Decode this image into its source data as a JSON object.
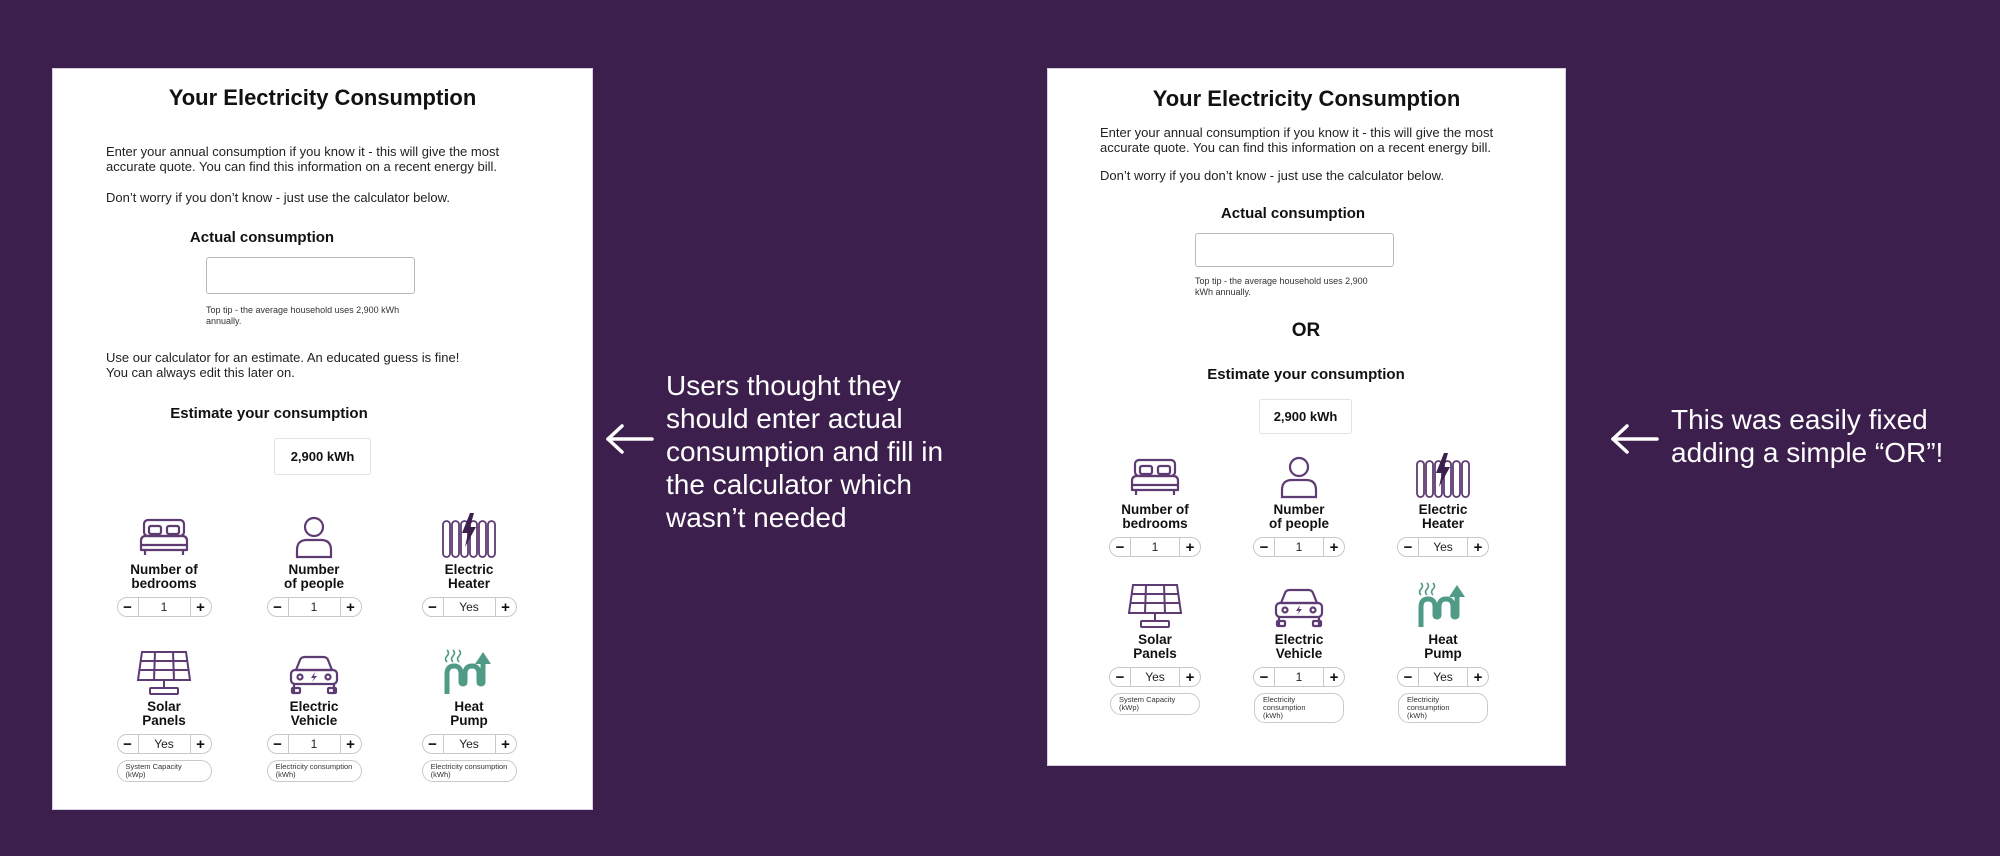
{
  "panels": {
    "left": {
      "title": "Your Electricity Consumption",
      "intro_1": "Enter your annual consumption if you know it - this will give the most accurate quote. You can find this information on a recent energy bill.",
      "intro_2": "Don’t worry if you don’t know - just use the calculator below.",
      "actual_label": "Actual consumption",
      "actual_value": "",
      "tip": "Top tip - the average household uses 2,900 kWh annually.",
      "calc_intro": "Use our calculator for an estimate. An educated guess is fine!\nYou can always edit this later on.",
      "estimate_label": "Estimate your consumption",
      "estimate_value": "2,900 kWh",
      "items": [
        {
          "label": "Number of\nbedrooms",
          "value": "1",
          "icon": "bed-icon"
        },
        {
          "label": "Number\nof people",
          "value": "1",
          "icon": "person-icon"
        },
        {
          "label": "Electric\nHeater",
          "value": "Yes",
          "icon": "electric-heater-icon"
        },
        {
          "label": "Solar\nPanels",
          "value": "Yes",
          "icon": "solar-panel-icon",
          "pill": "System Capacity (kWp)"
        },
        {
          "label": "Electric\nVehicle",
          "value": "1",
          "icon": "car-icon",
          "pill": "Electricity consumption\n(kWh)"
        },
        {
          "label": "Heat\nPump",
          "value": "Yes",
          "icon": "heat-pump-icon",
          "pill": "Electricity consumption\n(kWh)"
        }
      ]
    },
    "right": {
      "title": "Your Electricity Consumption",
      "intro_1": "Enter your annual consumption if you know it - this will give the most accurate quote. You can find this information on a recent energy bill.",
      "intro_2": "Don’t worry if you don’t know - just use the calculator below.",
      "actual_label": "Actual consumption",
      "actual_value": "",
      "tip": "Top tip - the average household uses 2,900 kWh annually.",
      "or_text": "OR",
      "estimate_label": "Estimate your consumption",
      "estimate_value": "2,900 kWh",
      "items": [
        {
          "label": "Number of\nbedrooms",
          "value": "1",
          "icon": "bed-icon"
        },
        {
          "label": "Number\nof people",
          "value": "1",
          "icon": "person-icon"
        },
        {
          "label": "Electric\nHeater",
          "value": "Yes",
          "icon": "electric-heater-icon"
        },
        {
          "label": "Solar\nPanels",
          "value": "Yes",
          "icon": "solar-panel-icon",
          "pill": "System Capacity (kWp)"
        },
        {
          "label": "Electric\nVehicle",
          "value": "1",
          "icon": "car-icon",
          "pill": "Electricity consumption\n(kWh)"
        },
        {
          "label": "Heat\nPump",
          "value": "Yes",
          "icon": "heat-pump-icon",
          "pill": "Electricity consumption\n(kWh)"
        }
      ]
    }
  },
  "annotations": {
    "left": "Users thought they\nshould enter actual\nconsumption and fill in\nthe calculator which\nwasn’t needed",
    "right": "This was easily fixed\nadding a simple “OR”!"
  },
  "stepper": {
    "minus": "−",
    "plus": "+"
  },
  "colors": {
    "background": "#3c1f4d",
    "icon_purple": "#5e3b72",
    "icon_teal": "#4f9b86",
    "bolt": "#3c1f4d"
  }
}
